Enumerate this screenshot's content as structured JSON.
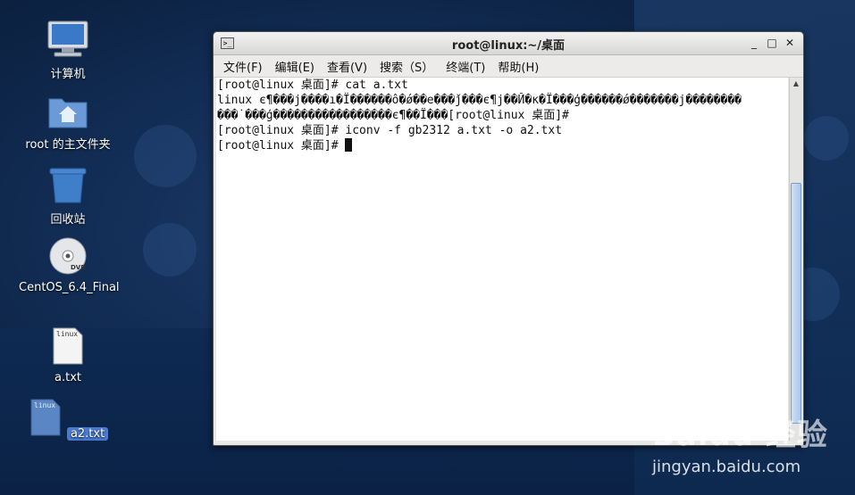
{
  "desktop": {
    "icons": [
      {
        "label": "计算机",
        "icon": "computer-icon"
      },
      {
        "label": "root 的主文件夹",
        "icon": "home-folder-icon"
      },
      {
        "label": "回收站",
        "icon": "trash-icon"
      },
      {
        "label": "CentOS_6.4_Final",
        "icon": "dvd-icon"
      },
      {
        "label": "a.txt",
        "icon": "text-file-icon",
        "thumb": "linux"
      },
      {
        "label": "a2.txt",
        "icon": "text-file-icon",
        "thumb": "linux"
      }
    ]
  },
  "window": {
    "title": "root@linux:~/桌面",
    "buttons": {
      "minimize": "_",
      "maximize": "□",
      "close": "✕"
    },
    "menu": [
      "文件(F)",
      "编辑(E)",
      "查看(V)",
      "搜索（S）",
      "终端(T)",
      "帮助(H)"
    ],
    "terminal_lines": [
      "[root@linux 桌面]# cat a.txt",
      "linux є¶���ј����ı�Ï������ô�ǿ��e���ǰ���є¶ј��Й�к�Ï���ģ������ǿ�������ј��������",
      "���˙���ģ�����������������є¶��Ï���[root@linux 桌面]#",
      "[root@linux 桌面]# iconv -f gb2312 a.txt -o a2.txt",
      "[root@linux 桌面]# "
    ]
  },
  "watermark": {
    "brand": "Baidu 经验",
    "url": "jingyan.baidu.com"
  }
}
